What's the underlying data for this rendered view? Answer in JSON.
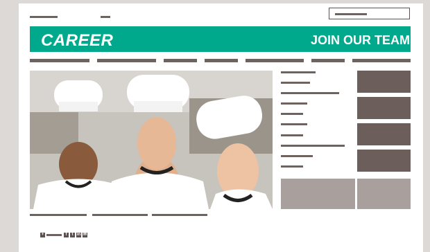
{
  "banner": {
    "left_text": "CAREER",
    "right_text": "JOIN OUR TEAM"
  },
  "hero": {
    "alt": "three smiling chefs in white uniforms"
  },
  "icons": {
    "plus": "plus-icon",
    "facebook": "facebook-icon",
    "twitter": "twitter-icon",
    "linkedin": "linkedin-icon",
    "email": "email-icon"
  },
  "colors": {
    "accent": "#00a88c",
    "tile": "#6b5e5b",
    "tile_light": "#a9a09e",
    "background": "#dcd9d7"
  }
}
